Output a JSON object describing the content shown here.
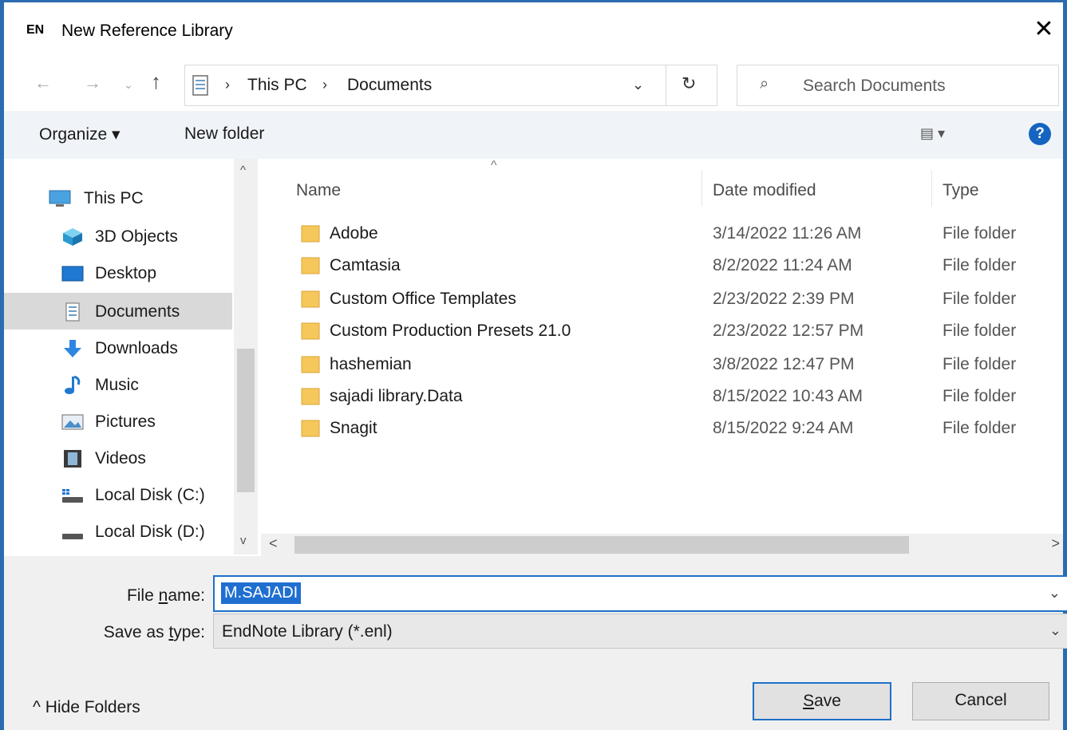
{
  "window": {
    "app_badge": "EN",
    "title": "New Reference Library",
    "close": "✕"
  },
  "nav": {
    "back": "←",
    "forward": "→",
    "recent": "⌄",
    "up": "↑"
  },
  "address": {
    "separator": "›",
    "crumbs": [
      "This PC",
      "Documents"
    ],
    "dropdown": "⌄",
    "refresh": "↻"
  },
  "search": {
    "icon": "⌕",
    "placeholder": "Search Documents"
  },
  "toolbar": {
    "organize": "Organize ▾",
    "new_folder": "New folder",
    "view": "▤ ▾",
    "help": "?"
  },
  "navpane": {
    "items": [
      {
        "label": "This PC",
        "icon": "computer-icon"
      },
      {
        "label": "3D Objects",
        "icon": "cube-icon"
      },
      {
        "label": "Desktop",
        "icon": "desktop-icon"
      },
      {
        "label": "Documents",
        "icon": "document-icon"
      },
      {
        "label": "Downloads",
        "icon": "download-icon"
      },
      {
        "label": "Music",
        "icon": "music-note-icon"
      },
      {
        "label": "Pictures",
        "icon": "picture-icon"
      },
      {
        "label": "Videos",
        "icon": "film-icon"
      },
      {
        "label": "Local Disk (C:)",
        "icon": "disk-c-icon"
      },
      {
        "label": "Local Disk (D:)",
        "icon": "disk-d-icon"
      }
    ],
    "selected": "Documents",
    "scroll_up": "^",
    "scroll_down": "v"
  },
  "filelist": {
    "sort_indicator": "^",
    "columns": {
      "name": "Name",
      "date": "Date modified",
      "type": "Type"
    },
    "rows": [
      {
        "name": "Adobe",
        "date": "3/14/2022 11:26 AM",
        "type": "File folder"
      },
      {
        "name": "Camtasia",
        "date": "8/2/2022 11:24 AM",
        "type": "File folder"
      },
      {
        "name": "Custom Office Templates",
        "date": "2/23/2022 2:39 PM",
        "type": "File folder"
      },
      {
        "name": "Custom Production Presets 21.0",
        "date": "2/23/2022 12:57 PM",
        "type": "File folder"
      },
      {
        "name": "hashemian",
        "date": "3/8/2022 12:47 PM",
        "type": "File folder"
      },
      {
        "name": "sajadi library.Data",
        "date": "8/15/2022 10:43 AM",
        "type": "File folder"
      },
      {
        "name": "Snagit",
        "date": "8/15/2022 9:24 AM",
        "type": "File folder"
      }
    ],
    "scroll_left": "<",
    "scroll_right": ">"
  },
  "form": {
    "filename_label_pre": "File ",
    "filename_label_u": "n",
    "filename_label_post": "ame:",
    "filename_value": "M.SAJADI",
    "savetype_label_pre": "Save as ",
    "savetype_label_u": "t",
    "savetype_label_post": "ype:",
    "savetype_value": "EndNote Library (*.enl)",
    "dropdown": "⌄"
  },
  "footer": {
    "hide_folders": "^  Hide Folders",
    "save_u": "S",
    "save_rest": "ave",
    "cancel": "Cancel"
  },
  "colors": {
    "accent": "#1e70c8",
    "window_border": "#2b6cb0",
    "folder": "#f6c75a",
    "selection": "#d9d9d9"
  }
}
